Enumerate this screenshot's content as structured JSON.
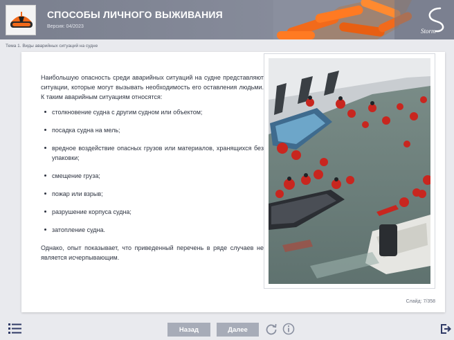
{
  "header": {
    "title": "СПОСОБЫ ЛИЧНОГО ВЫЖИВАНИЯ",
    "version": "Версия: 04/2023",
    "logo_icon": "life-raft-icon",
    "brand_icon": "storm-logo-icon",
    "brand_text": "Storm"
  },
  "breadcrumb": "Тема 1. Виды аварийных ситуаций на судне",
  "content": {
    "intro": "Наибольшую опасность среди аварийных ситуаций на судне представляют ситуации, которые могут вызывать необходимость его оставления людьми. К таким аварийным ситуациям относятся:",
    "items": [
      "столкновение судна с другим судном или объектом;",
      "посадка судна на мель;",
      "вредное воздействие опасных грузов или материалов, хранящихся без упаковки;",
      "смещение груза;",
      "пожар или взрыв;",
      "разрушение корпуса судна;",
      "затопление судна."
    ],
    "outro": "Однако, опыт показывает, что приведенный перечень в ряде случаев не является исчерпывающим."
  },
  "slide_counter": "Слайд: 7/358",
  "footer": {
    "back_label": "Назад",
    "next_label": "Далее",
    "menu_icon": "list-menu-icon",
    "reload_icon": "reload-icon",
    "info_icon": "info-icon",
    "exit_icon": "exit-icon"
  },
  "colors": {
    "header_bg": "#858a99",
    "button_bg": "#a7acb8",
    "accent_orange": "#f26a1b",
    "icon_navy": "#2f3a66"
  }
}
